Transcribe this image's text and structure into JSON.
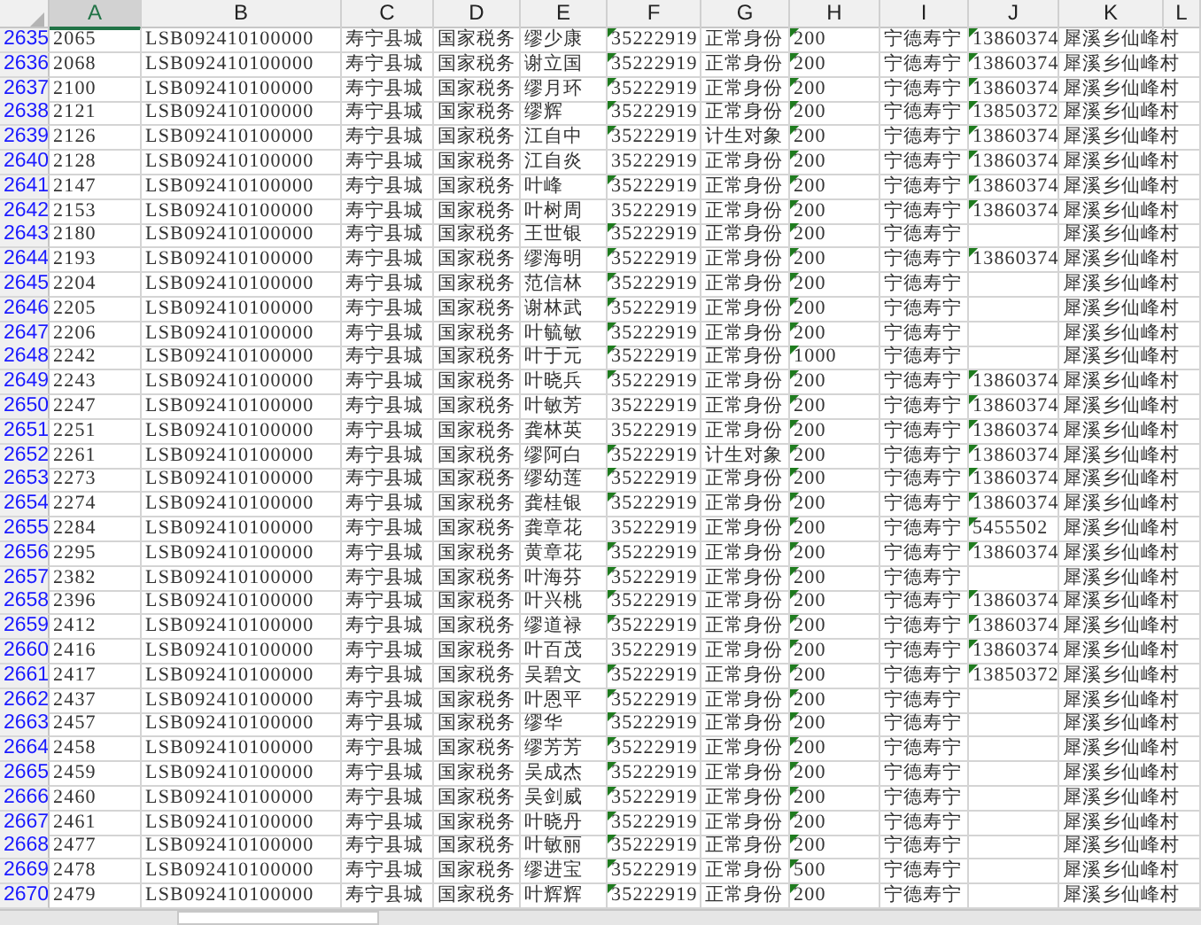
{
  "columns": [
    {
      "label": "A",
      "selected": true
    },
    {
      "label": "B",
      "selected": false
    },
    {
      "label": "C",
      "selected": false
    },
    {
      "label": "D",
      "selected": false
    },
    {
      "label": "E",
      "selected": false
    },
    {
      "label": "F",
      "selected": false
    },
    {
      "label": "G",
      "selected": false
    },
    {
      "label": "H",
      "selected": false
    },
    {
      "label": "I",
      "selected": false
    },
    {
      "label": "J",
      "selected": false
    },
    {
      "label": "K",
      "selected": false
    },
    {
      "label": "L",
      "selected": false
    }
  ],
  "rows": [
    {
      "n": "2635",
      "a": "2065",
      "b": "LSB092410100000",
      "c": "寿宁县城",
      "d": "国家税务",
      "e": "缪少康",
      "f": "35222919",
      "f_flag": true,
      "g": "正常身份",
      "h": "200",
      "h_flag": true,
      "i": "宁德寿宁",
      "j": "13860374",
      "j_flag": true,
      "k": "犀溪乡仙峰村"
    },
    {
      "n": "2636",
      "a": "2068",
      "b": "LSB092410100000",
      "c": "寿宁县城",
      "d": "国家税务",
      "e": "谢立国",
      "f": "35222919",
      "f_flag": true,
      "g": "正常身份",
      "h": "200",
      "h_flag": true,
      "i": "宁德寿宁",
      "j": "13860374",
      "j_flag": true,
      "k": "犀溪乡仙峰村"
    },
    {
      "n": "2637",
      "a": "2100",
      "b": "LSB092410100000",
      "c": "寿宁县城",
      "d": "国家税务",
      "e": "缪月环",
      "f": "35222919",
      "f_flag": true,
      "g": "正常身份",
      "h": "200",
      "h_flag": true,
      "i": "宁德寿宁",
      "j": "13860374",
      "j_flag": true,
      "k": "犀溪乡仙峰村"
    },
    {
      "n": "2638",
      "a": "2121",
      "b": "LSB092410100000",
      "c": "寿宁县城",
      "d": "国家税务",
      "e": "缪辉",
      "f": "35222919",
      "f_flag": true,
      "g": "正常身份",
      "h": "200",
      "h_flag": true,
      "i": "宁德寿宁",
      "j": "13850372",
      "j_flag": true,
      "k": "犀溪乡仙峰村"
    },
    {
      "n": "2639",
      "a": "2126",
      "b": "LSB092410100000",
      "c": "寿宁县城",
      "d": "国家税务",
      "e": "江自中",
      "f": "35222919",
      "f_flag": true,
      "g": "计生对象",
      "h": "200",
      "h_flag": true,
      "i": "宁德寿宁",
      "j": "13860374",
      "j_flag": true,
      "k": "犀溪乡仙峰村"
    },
    {
      "n": "2640",
      "a": "2128",
      "b": "LSB092410100000",
      "c": "寿宁县城",
      "d": "国家税务",
      "e": "江自炎",
      "f": "35222919",
      "f_flag": false,
      "g": "正常身份",
      "h": "200",
      "h_flag": true,
      "i": "宁德寿宁",
      "j": "13860374",
      "j_flag": true,
      "k": "犀溪乡仙峰村"
    },
    {
      "n": "2641",
      "a": "2147",
      "b": "LSB092410100000",
      "c": "寿宁县城",
      "d": "国家税务",
      "e": "叶峰",
      "f": "35222919",
      "f_flag": true,
      "g": "正常身份",
      "h": "200",
      "h_flag": true,
      "i": "宁德寿宁",
      "j": "13860374",
      "j_flag": true,
      "k": "犀溪乡仙峰村"
    },
    {
      "n": "2642",
      "a": "2153",
      "b": "LSB092410100000",
      "c": "寿宁县城",
      "d": "国家税务",
      "e": "叶树周",
      "f": "35222919",
      "f_flag": false,
      "g": "正常身份",
      "h": "200",
      "h_flag": true,
      "i": "宁德寿宁",
      "j": "13860374",
      "j_flag": true,
      "k": "犀溪乡仙峰村"
    },
    {
      "n": "2643",
      "a": "2180",
      "b": "LSB092410100000",
      "c": "寿宁县城",
      "d": "国家税务",
      "e": "王世银",
      "f": "35222919",
      "f_flag": true,
      "g": "正常身份",
      "h": "200",
      "h_flag": true,
      "i": "宁德寿宁",
      "j_flag": false,
      "k": "犀溪乡仙峰村"
    },
    {
      "n": "2644",
      "a": "2193",
      "b": "LSB092410100000",
      "c": "寿宁县城",
      "d": "国家税务",
      "e": "缪海明",
      "f": "35222919",
      "f_flag": true,
      "g": "正常身份",
      "h": "200",
      "h_flag": true,
      "i": "宁德寿宁",
      "j": "13860374",
      "j_flag": true,
      "k": "犀溪乡仙峰村"
    },
    {
      "n": "2645",
      "a": "2204",
      "b": "LSB092410100000",
      "c": "寿宁县城",
      "d": "国家税务",
      "e": "范信林",
      "f": "35222919",
      "f_flag": true,
      "g": "正常身份",
      "h": "200",
      "h_flag": true,
      "i": "宁德寿宁",
      "j_flag": false,
      "k": "犀溪乡仙峰村"
    },
    {
      "n": "2646",
      "a": "2205",
      "b": "LSB092410100000",
      "c": "寿宁县城",
      "d": "国家税务",
      "e": "谢林武",
      "f": "35222919",
      "f_flag": true,
      "g": "正常身份",
      "h": "200",
      "h_flag": true,
      "i": "宁德寿宁",
      "j_flag": false,
      "k": "犀溪乡仙峰村"
    },
    {
      "n": "2647",
      "a": "2206",
      "b": "LSB092410100000",
      "c": "寿宁县城",
      "d": "国家税务",
      "e": "叶毓敏",
      "f": "35222919",
      "f_flag": true,
      "g": "正常身份",
      "h": "200",
      "h_flag": true,
      "i": "宁德寿宁",
      "j_flag": false,
      "k": "犀溪乡仙峰村"
    },
    {
      "n": "2648",
      "a": "2242",
      "b": "LSB092410100000",
      "c": "寿宁县城",
      "d": "国家税务",
      "e": "叶于元",
      "f": "35222919",
      "f_flag": true,
      "g": "正常身份",
      "h": "1000",
      "h_flag": true,
      "i": "宁德寿宁",
      "j_flag": false,
      "k": "犀溪乡仙峰村"
    },
    {
      "n": "2649",
      "a": "2243",
      "b": "LSB092410100000",
      "c": "寿宁县城",
      "d": "国家税务",
      "e": "叶晓兵",
      "f": "35222919",
      "f_flag": true,
      "g": "正常身份",
      "h": "200",
      "h_flag": true,
      "i": "宁德寿宁",
      "j": "13860374",
      "j_flag": true,
      "k": "犀溪乡仙峰村"
    },
    {
      "n": "2650",
      "a": "2247",
      "b": "LSB092410100000",
      "c": "寿宁县城",
      "d": "国家税务",
      "e": "叶敏芳",
      "f": "35222919",
      "f_flag": false,
      "g": "正常身份",
      "h": "200",
      "h_flag": true,
      "i": "宁德寿宁",
      "j": "13860374",
      "j_flag": true,
      "k": "犀溪乡仙峰村"
    },
    {
      "n": "2651",
      "a": "2251",
      "b": "LSB092410100000",
      "c": "寿宁县城",
      "d": "国家税务",
      "e": "龚林英",
      "f": "35222919",
      "f_flag": false,
      "g": "正常身份",
      "h": "200",
      "h_flag": true,
      "i": "宁德寿宁",
      "j": "13860374",
      "j_flag": true,
      "k": "犀溪乡仙峰村"
    },
    {
      "n": "2652",
      "a": "2261",
      "b": "LSB092410100000",
      "c": "寿宁县城",
      "d": "国家税务",
      "e": "缪阿白",
      "f": "35222919",
      "f_flag": true,
      "g": "计生对象",
      "h": "200",
      "h_flag": true,
      "i": "宁德寿宁",
      "j": "13860374",
      "j_flag": true,
      "k": "犀溪乡仙峰村"
    },
    {
      "n": "2653",
      "a": "2273",
      "b": "LSB092410100000",
      "c": "寿宁县城",
      "d": "国家税务",
      "e": "缪幼莲",
      "f": "35222919",
      "f_flag": true,
      "g": "正常身份",
      "h": "200",
      "h_flag": true,
      "i": "宁德寿宁",
      "j": "13860374",
      "j_flag": true,
      "k": "犀溪乡仙峰村"
    },
    {
      "n": "2654",
      "a": "2274",
      "b": "LSB092410100000",
      "c": "寿宁县城",
      "d": "国家税务",
      "e": "龚桂银",
      "f": "35222919",
      "f_flag": true,
      "g": "正常身份",
      "h": "200",
      "h_flag": true,
      "i": "宁德寿宁",
      "j": "13860374",
      "j_flag": true,
      "k": "犀溪乡仙峰村"
    },
    {
      "n": "2655",
      "a": "2284",
      "b": "LSB092410100000",
      "c": "寿宁县城",
      "d": "国家税务",
      "e": "龚章花",
      "f": "35222919",
      "f_flag": false,
      "g": "正常身份",
      "h": "200",
      "h_flag": true,
      "i": "宁德寿宁",
      "j": "5455502",
      "j_flag": true,
      "k": "犀溪乡仙峰村"
    },
    {
      "n": "2656",
      "a": "2295",
      "b": "LSB092410100000",
      "c": "寿宁县城",
      "d": "国家税务",
      "e": "黄章花",
      "f": "35222919",
      "f_flag": true,
      "g": "正常身份",
      "h": "200",
      "h_flag": true,
      "i": "宁德寿宁",
      "j": "13860374",
      "j_flag": true,
      "k": "犀溪乡仙峰村"
    },
    {
      "n": "2657",
      "a": "2382",
      "b": "LSB092410100000",
      "c": "寿宁县城",
      "d": "国家税务",
      "e": "叶海芬",
      "f": "35222919",
      "f_flag": true,
      "g": "正常身份",
      "h": "200",
      "h_flag": true,
      "i": "宁德寿宁",
      "j_flag": false,
      "k": "犀溪乡仙峰村"
    },
    {
      "n": "2658",
      "a": "2396",
      "b": "LSB092410100000",
      "c": "寿宁县城",
      "d": "国家税务",
      "e": "叶兴桃",
      "f": "35222919",
      "f_flag": true,
      "g": "正常身份",
      "h": "200",
      "h_flag": true,
      "i": "宁德寿宁",
      "j": "13860374",
      "j_flag": true,
      "k": "犀溪乡仙峰村"
    },
    {
      "n": "2659",
      "a": "2412",
      "b": "LSB092410100000",
      "c": "寿宁县城",
      "d": "国家税务",
      "e": "缪道禄",
      "f": "35222919",
      "f_flag": true,
      "g": "正常身份",
      "h": "200",
      "h_flag": true,
      "i": "宁德寿宁",
      "j": "13860374",
      "j_flag": true,
      "k": "犀溪乡仙峰村"
    },
    {
      "n": "2660",
      "a": "2416",
      "b": "LSB092410100000",
      "c": "寿宁县城",
      "d": "国家税务",
      "e": "叶百茂",
      "f": "35222919",
      "f_flag": false,
      "g": "正常身份",
      "h": "200",
      "h_flag": true,
      "i": "宁德寿宁",
      "j": "13860374",
      "j_flag": true,
      "k": "犀溪乡仙峰村"
    },
    {
      "n": "2661",
      "a": "2417",
      "b": "LSB092410100000",
      "c": "寿宁县城",
      "d": "国家税务",
      "e": "吴碧文",
      "f": "35222919",
      "f_flag": true,
      "g": "正常身份",
      "h": "200",
      "h_flag": true,
      "i": "宁德寿宁",
      "j": "13850372",
      "j_flag": true,
      "k": "犀溪乡仙峰村"
    },
    {
      "n": "2662",
      "a": "2437",
      "b": "LSB092410100000",
      "c": "寿宁县城",
      "d": "国家税务",
      "e": "叶恩平",
      "f": "35222919",
      "f_flag": true,
      "g": "正常身份",
      "h": "200",
      "h_flag": true,
      "i": "宁德寿宁",
      "j_flag": false,
      "k": "犀溪乡仙峰村"
    },
    {
      "n": "2663",
      "a": "2457",
      "b": "LSB092410100000",
      "c": "寿宁县城",
      "d": "国家税务",
      "e": "缪华",
      "f": "35222919",
      "f_flag": true,
      "g": "正常身份",
      "h": "200",
      "h_flag": true,
      "i": "宁德寿宁",
      "j_flag": false,
      "k": "犀溪乡仙峰村"
    },
    {
      "n": "2664",
      "a": "2458",
      "b": "LSB092410100000",
      "c": "寿宁县城",
      "d": "国家税务",
      "e": "缪芳芳",
      "f": "35222919",
      "f_flag": true,
      "g": "正常身份",
      "h": "200",
      "h_flag": true,
      "i": "宁德寿宁",
      "j_flag": false,
      "k": "犀溪乡仙峰村"
    },
    {
      "n": "2665",
      "a": "2459",
      "b": "LSB092410100000",
      "c": "寿宁县城",
      "d": "国家税务",
      "e": "吴成杰",
      "f": "35222919",
      "f_flag": true,
      "g": "正常身份",
      "h": "200",
      "h_flag": true,
      "i": "宁德寿宁",
      "j_flag": false,
      "k": "犀溪乡仙峰村"
    },
    {
      "n": "2666",
      "a": "2460",
      "b": "LSB092410100000",
      "c": "寿宁县城",
      "d": "国家税务",
      "e": "吴剑威",
      "f": "35222919",
      "f_flag": true,
      "g": "正常身份",
      "h": "200",
      "h_flag": true,
      "i": "宁德寿宁",
      "j_flag": false,
      "k": "犀溪乡仙峰村"
    },
    {
      "n": "2667",
      "a": "2461",
      "b": "LSB092410100000",
      "c": "寿宁县城",
      "d": "国家税务",
      "e": "叶晓丹",
      "f": "35222919",
      "f_flag": true,
      "g": "正常身份",
      "h": "200",
      "h_flag": true,
      "i": "宁德寿宁",
      "j_flag": false,
      "k": "犀溪乡仙峰村"
    },
    {
      "n": "2668",
      "a": "2477",
      "b": "LSB092410100000",
      "c": "寿宁县城",
      "d": "国家税务",
      "e": "叶敏丽",
      "f": "35222919",
      "f_flag": true,
      "g": "正常身份",
      "h": "200",
      "h_flag": true,
      "i": "宁德寿宁",
      "j_flag": false,
      "k": "犀溪乡仙峰村"
    },
    {
      "n": "2669",
      "a": "2478",
      "b": "LSB092410100000",
      "c": "寿宁县城",
      "d": "国家税务",
      "e": "缪进宝",
      "f": "35222919",
      "f_flag": true,
      "g": "正常身份",
      "h": "500",
      "h_flag": true,
      "i": "宁德寿宁",
      "j_flag": false,
      "k": "犀溪乡仙峰村"
    },
    {
      "n": "2670",
      "a": "2479",
      "b": "LSB092410100000",
      "c": "寿宁县城",
      "d": "国家税务",
      "e": "叶辉辉",
      "f": "35222919",
      "f_flag": true,
      "g": "正常身份",
      "h": "200",
      "h_flag": true,
      "i": "宁德寿宁",
      "j_flag": false,
      "k": "犀溪乡仙峰村"
    }
  ]
}
